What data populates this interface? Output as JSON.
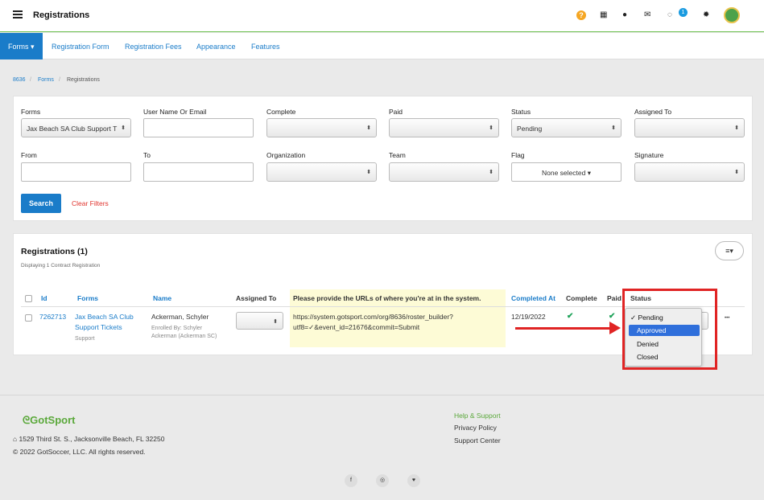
{
  "header": {
    "title": "Registrations",
    "notification_count": "1"
  },
  "nav": {
    "forms": "Forms ▾",
    "items": [
      "Registration Form",
      "Registration Fees",
      "Appearance",
      "Features"
    ]
  },
  "breadcrumb": [
    "8636",
    "Forms",
    "Registrations"
  ],
  "filters": {
    "forms_label": "Forms",
    "forms_value": "Jax Beach SA Club Support T",
    "user_label": "User Name Or Email",
    "complete_label": "Complete",
    "paid_label": "Paid",
    "status_label": "Status",
    "status_value": "Pending",
    "assigned_label": "Assigned To",
    "from_label": "From",
    "to_label": "To",
    "org_label": "Organization",
    "team_label": "Team",
    "flag_label": "Flag",
    "flag_value": "None selected ▾",
    "signature_label": "Signature",
    "search": "Search",
    "clear": "Clear Filters"
  },
  "registrations": {
    "title": "Registrations (1)",
    "subtitle": "Displaying 1 Contract Registration",
    "menu": "≡▾",
    "columns": [
      "Id",
      "Forms",
      "Name",
      "Assigned To",
      "Please provide the URLs of where you're at in the system.",
      "Completed At",
      "Complete",
      "Paid",
      "Status"
    ],
    "row": {
      "id": "7262713",
      "form_line1": "Jax Beach SA Club",
      "form_line2": "Support Tickets",
      "form_sub": "Support",
      "name": "Ackerman, Schyler",
      "enrolled_line1": "Enrolled By: Schyler",
      "enrolled_line2": "Ackerman (Ackerman SC)",
      "url_line1": "https://system.gotsport.com/org/8636/roster_builder?",
      "url_line2": "utf8=✓&event_id=21676&commit=Submit",
      "completed_at": "12/19/2022",
      "more": "•••"
    },
    "status_options": [
      "✓ Pending",
      "Approved",
      "Denied",
      "Closed"
    ]
  },
  "footer": {
    "logo": "GotSport",
    "address": "1529 Third St. S., Jacksonville Beach, FL 32250",
    "copyright": "© 2022 GotSoccer, LLC. All rights reserved.",
    "links": [
      "Help & Support",
      "Privacy Policy",
      "Support Center"
    ],
    "social": [
      "f",
      "◎",
      "♥"
    ]
  },
  "colors": {
    "primary": "#1a7cc9",
    "accent_green": "#5aa83a",
    "annotation_red": "#e02424"
  }
}
